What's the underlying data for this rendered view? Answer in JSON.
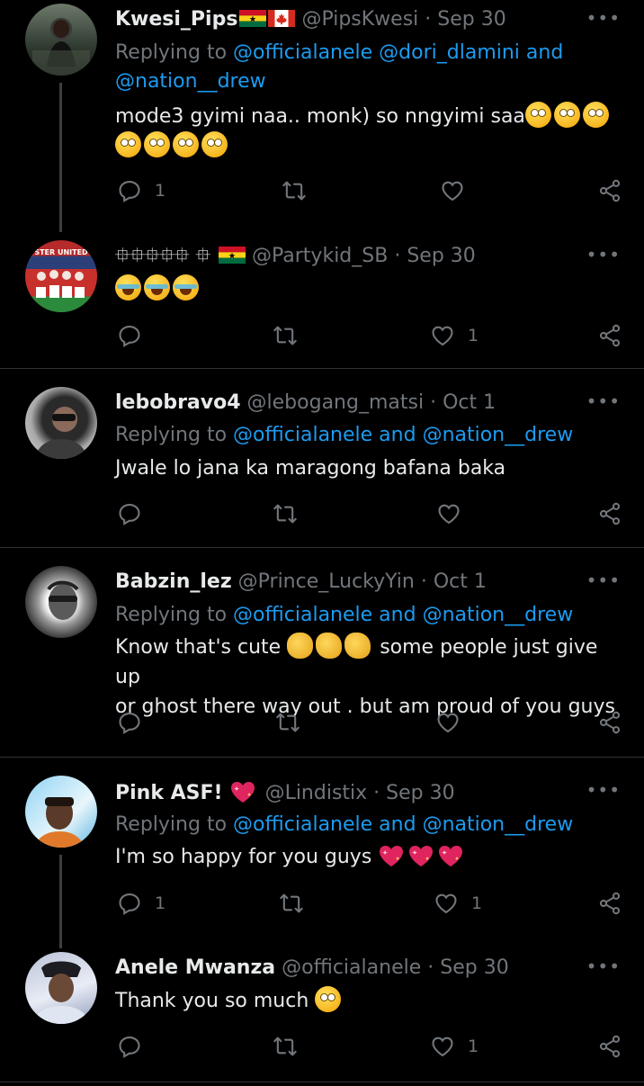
{
  "tweets": [
    {
      "name": "Kwesi_Pips",
      "name_emoji": "ghana-flag canada-flag",
      "handle": "@PipsKwesi",
      "date": "Sep 30",
      "replying_label": "Replying to",
      "reply_to_1": "@officialanele",
      "reply_to_2": "@dori_dlamini",
      "reply_join": "and",
      "reply_to_3": "@nation__drew",
      "text": "mode3 gyimi naa.. monk) so nngyimi saa",
      "text_emoji": "face-with-rolling-eyes x7",
      "reply_count": "1",
      "like_count": ""
    },
    {
      "name": "⯐⯐⯐⯐⯐ ⯐",
      "name_emoji": "ghana-flag",
      "handle": "@Partykid_SB",
      "date": "Sep 30",
      "text_emoji": "face-with-tears-of-joy x3",
      "reply_count": "",
      "like_count": "1",
      "avatar_text": "STER UNITED"
    },
    {
      "name": "lebobravo4",
      "handle": "@lebogang_matsi",
      "date": "Oct 1",
      "replying_label": "Replying to",
      "reply_to_1": "@officialanele",
      "reply_join": "and",
      "reply_to_2": "@nation__drew",
      "text": "Jwale lo jana ka maragong bafana baka",
      "reply_count": "",
      "like_count": ""
    },
    {
      "name": "Babzin_lez",
      "handle": "@Prince_LuckyYin",
      "date": "Oct 1",
      "replying_label": "Replying to",
      "reply_to_1": "@officialanele",
      "reply_join": "and",
      "reply_to_2": "@nation__drew",
      "text_a": "Know that's cute",
      "text_emoji": "ok-hand clapping-hands x2",
      "text_b": "some people just give up",
      "text_c": "or ghost there way out . but am proud of you guys",
      "reply_count": "",
      "like_count": ""
    },
    {
      "name": "Pink ASF!",
      "name_emoji": "sparkling-heart",
      "handle": "@Lindistix",
      "date": "Sep 30",
      "replying_label": "Replying to",
      "reply_to_1": "@officialanele",
      "reply_join": "and",
      "reply_to_2": "@nation__drew",
      "text": "I'm so happy for you guys",
      "text_emoji": "sparkling-heart x3",
      "reply_count": "1",
      "like_count": "1"
    },
    {
      "name": "Anele Mwanza",
      "handle": "@officialanele",
      "date": "Sep 30",
      "text": "Thank you so much",
      "text_emoji": "face-with-rolling-eyes",
      "reply_count": "",
      "like_count": "1"
    }
  ],
  "sep": "·",
  "more_label": "•••",
  "colors": {
    "background": "#000000",
    "link": "#1d9bf0",
    "muted": "#71767b",
    "text": "#e7e9ea",
    "divider": "#2f3336"
  }
}
